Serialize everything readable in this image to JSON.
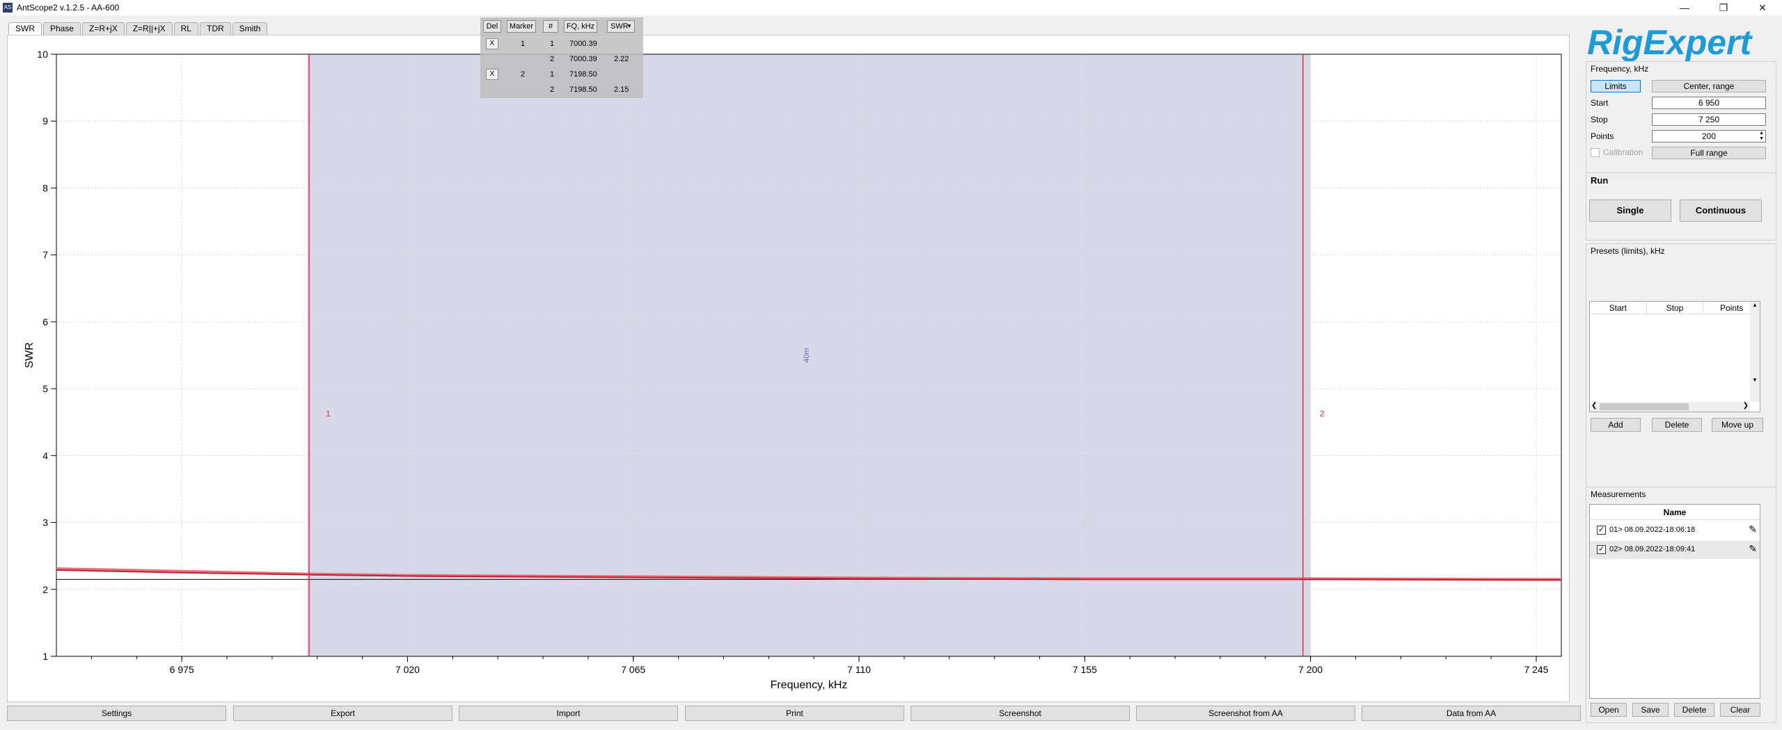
{
  "window": {
    "title": "AntScope2 v.1.2.5 - AA-600",
    "icon_text": "AS"
  },
  "tabs": [
    {
      "label": "SWR",
      "active": true
    },
    {
      "label": "Phase"
    },
    {
      "label": "Z=R+jX"
    },
    {
      "label": "Z=R||+jX"
    },
    {
      "label": "RL"
    },
    {
      "label": "TDR"
    },
    {
      "label": "Smith"
    }
  ],
  "marker_table": {
    "headers": [
      "Del",
      "Marker",
      "#",
      "FQ, kHz",
      "SWR"
    ],
    "delete_label": "X",
    "rows": [
      {
        "marker": "1",
        "num": "1",
        "fq": "7000.39",
        "swr": "",
        "del": true
      },
      {
        "marker": "",
        "num": "2",
        "fq": "7000.39",
        "swr": "2.22",
        "del": false
      },
      {
        "marker": "2",
        "num": "1",
        "fq": "7198.50",
        "swr": "",
        "del": true
      },
      {
        "marker": "",
        "num": "2",
        "fq": "7198.50",
        "swr": "2.15",
        "del": false
      }
    ]
  },
  "chart_data": {
    "type": "line",
    "xlabel": "Frequency, kHz",
    "ylabel": "SWR",
    "xlim": [
      6950,
      7250
    ],
    "ylim": [
      1,
      10
    ],
    "x_ticks": [
      6975,
      7020,
      7065,
      7110,
      7155,
      7200,
      7245
    ],
    "x_tick_labels": [
      "6 975",
      "7 020",
      "7 065",
      "7 110",
      "7 155",
      "7 200",
      "7 245"
    ],
    "y_ticks": [
      1,
      2,
      3,
      4,
      5,
      6,
      7,
      8,
      9,
      10
    ],
    "y_tick_labels": [
      "1",
      "2",
      "3",
      "4",
      "5",
      "6",
      "7",
      "8",
      "9",
      "10"
    ],
    "grid": true,
    "band": {
      "label": "40m",
      "start": 7000,
      "end": 7200,
      "color": "#d8d8e8"
    },
    "markers": [
      {
        "label": "1",
        "x": 7000.39
      },
      {
        "label": "2",
        "x": 7198.5
      }
    ],
    "reference_line": {
      "y": 2.15
    },
    "series": [
      {
        "color": "#e8707a",
        "x": [
          6950,
          6975,
          7000,
          7020,
          7065,
          7110,
          7155,
          7200,
          7245,
          7250
        ],
        "values": [
          2.31,
          2.27,
          2.23,
          2.21,
          2.19,
          2.17,
          2.16,
          2.16,
          2.15,
          2.15
        ]
      },
      {
        "color": "#c02030",
        "x": [
          6950,
          6975,
          7000,
          7020,
          7065,
          7110,
          7155,
          7200,
          7245,
          7250
        ],
        "values": [
          2.29,
          2.25,
          2.22,
          2.2,
          2.18,
          2.16,
          2.15,
          2.15,
          2.14,
          2.14
        ]
      }
    ]
  },
  "right_panel": {
    "logo_text": "RigExpert",
    "frequency": {
      "title": "Frequency, kHz",
      "limits_label": "Limits",
      "center_range_label": "Center, range",
      "start_label": "Start",
      "start_value": "6 950",
      "stop_label": "Stop",
      "stop_value": "7 250",
      "points_label": "Points",
      "points_value": "200",
      "calibration_label": "Calibration",
      "full_range_label": "Full range"
    },
    "run": {
      "title": "Run",
      "single_label": "Single",
      "continuous_label": "Continuous"
    },
    "presets": {
      "title": "Presets (limits), kHz",
      "columns": [
        "Start",
        "Stop",
        "Points"
      ],
      "add_label": "Add",
      "delete_label": "Delete",
      "move_up_label": "Move up"
    },
    "measurements": {
      "title": "Measurements",
      "column": "Name",
      "items": [
        {
          "name": "01> 08.09.2022-18:06:18",
          "checked": true
        },
        {
          "name": "02> 08.09.2022-18:09:41",
          "checked": true
        }
      ],
      "open_label": "Open",
      "save_label": "Save",
      "delete_label": "Delete",
      "clear_label": "Clear"
    }
  },
  "bottom_bar": {
    "buttons": [
      "Settings",
      "Export",
      "Import",
      "Print",
      "Screenshot",
      "Screenshot from AA",
      "Data from AA"
    ]
  },
  "colors": {
    "accent_logo": "#1e9ad6",
    "band": "#d8d8e8",
    "marker": "#e03040"
  }
}
